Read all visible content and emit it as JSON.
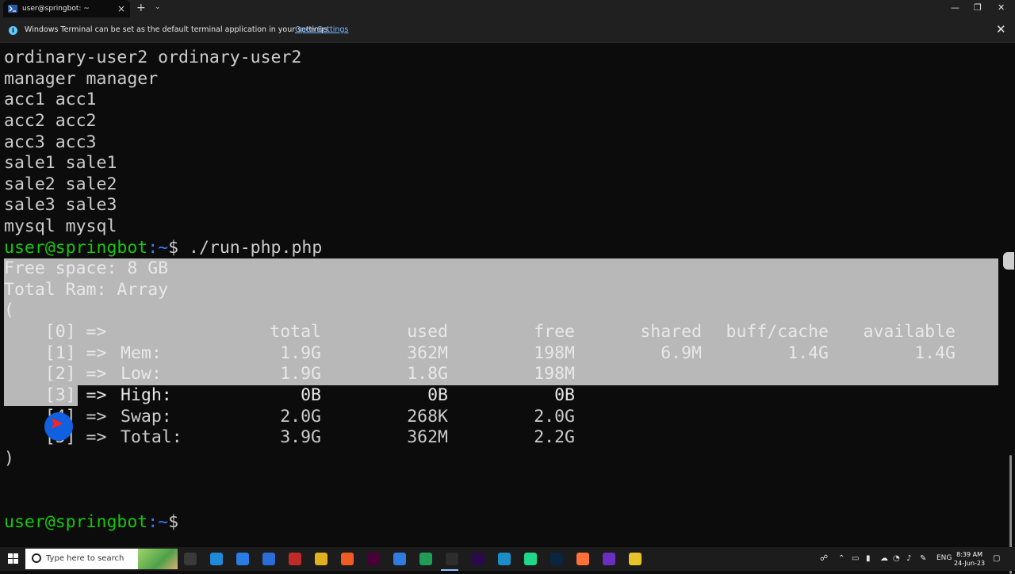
{
  "window": {
    "tab_title": "user@springbot: ~",
    "minimize_glyph": "—",
    "maximize_glyph": "❐",
    "close_glyph": "✕",
    "new_tab_glyph": "+",
    "dropdown_glyph": "⌄",
    "tab_close_glyph": "×"
  },
  "infobar": {
    "message": "Windows Terminal can be set as the default terminal application in your settings.",
    "link": "Open Settings",
    "close_glyph": "✕"
  },
  "terminal": {
    "prompt_user": "user@springbot",
    "prompt_path": ":~",
    "prompt_symbol": "$ ",
    "earlier_lines": [
      "ordinary-user2 ordinary-user2",
      "manager manager",
      "acc1 acc1",
      "acc2 acc2",
      "acc3 acc3",
      "sale1 sale1",
      "sale2 sale2",
      "sale3 sale3",
      "mysql mysql"
    ],
    "command": "./run-php.php",
    "free_space": "Free space: 8 GB",
    "total_ram": "Total Ram: Array",
    "open_paren": "(",
    "close_paren": ")",
    "rows": [
      [
        "[0] =>",
        "",
        "total",
        "used",
        "free",
        "shared",
        "buff/cache",
        "available"
      ],
      [
        "[1] =>",
        "Mem:",
        "1.9G",
        "362M",
        "198M",
        "6.9M",
        "1.4G",
        "1.4G"
      ],
      [
        "[2] =>",
        "Low:",
        "1.9G",
        "1.8G",
        "198M",
        "",
        "",
        ""
      ],
      [
        "[3] =>",
        "High:",
        "0B",
        "0B",
        "0B",
        "",
        "",
        ""
      ],
      [
        "[4] =>",
        "Swap:",
        "2.0G",
        "268K",
        "2.0G",
        "",
        "",
        ""
      ],
      [
        "[5] =>",
        "Total:",
        "3.9G",
        "362M",
        "2.2G",
        "",
        "",
        ""
      ]
    ]
  },
  "taskbar": {
    "search_placeholder": "Type here to search",
    "language": "ENG",
    "time": "8:39 AM",
    "date": "24-Jun-23",
    "apps": [
      {
        "name": "task-view",
        "color": "#3a3a3a"
      },
      {
        "name": "edge",
        "color": "#1f8bd8"
      },
      {
        "name": "mail",
        "color": "#2a7be4"
      },
      {
        "name": "visual-studio",
        "color": "#2b6cd8"
      },
      {
        "name": "app-red",
        "color": "#c22a2a"
      },
      {
        "name": "chrome",
        "color": "#e0b020"
      },
      {
        "name": "brave",
        "color": "#f05a24"
      },
      {
        "name": "adobe-xd",
        "color": "#470137"
      },
      {
        "name": "todo",
        "color": "#2f7be0"
      },
      {
        "name": "app-green",
        "color": "#1f9d55"
      },
      {
        "name": "terminal",
        "color": "#2d2d2d"
      },
      {
        "name": "premiere",
        "color": "#2a0a4a"
      },
      {
        "name": "app-3",
        "color": "#1c8dc7"
      },
      {
        "name": "pycharm",
        "color": "#21d789"
      },
      {
        "name": "photoshop",
        "color": "#0a2540"
      },
      {
        "name": "firefox",
        "color": "#ff7139"
      },
      {
        "name": "jetbrains",
        "color": "#6b2fbf"
      },
      {
        "name": "app-yellow",
        "color": "#e8c32a"
      }
    ]
  }
}
